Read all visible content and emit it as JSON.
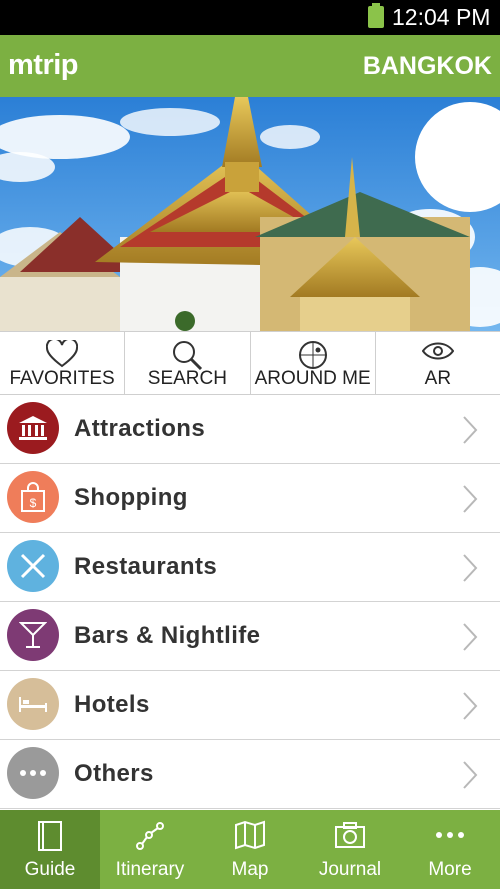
{
  "status_bar": {
    "time": "12:04 PM"
  },
  "header": {
    "app_name": "mtrip",
    "city": "BANGKOK"
  },
  "hero": {
    "image": "grand-palace-photo"
  },
  "quick_actions": [
    {
      "label": "FAVORITES",
      "icon": "heart-icon"
    },
    {
      "label": "SEARCH",
      "icon": "magnifier-icon"
    },
    {
      "label": "AROUND ME",
      "icon": "compass-icon"
    },
    {
      "label": "AR",
      "icon": "eye-icon"
    }
  ],
  "categories": [
    {
      "label": "Attractions",
      "icon": "museum-icon",
      "color": "#9b1b1f"
    },
    {
      "label": "Shopping",
      "icon": "shopping-bag-icon",
      "color": "#ef7d5a"
    },
    {
      "label": "Restaurants",
      "icon": "cutlery-icon",
      "color": "#5fb2df"
    },
    {
      "label": "Bars & Nightlife",
      "icon": "cocktail-icon",
      "color": "#7e3a74"
    },
    {
      "label": "Hotels",
      "icon": "bed-icon",
      "color": "#d6be99"
    },
    {
      "label": "Others",
      "icon": "more-dots-icon",
      "color": "#9a9a9a"
    }
  ],
  "tabs": [
    {
      "label": "Guide",
      "icon": "book-icon",
      "active": true
    },
    {
      "label": "Itinerary",
      "icon": "route-icon",
      "active": false
    },
    {
      "label": "Map",
      "icon": "map-icon",
      "active": false
    },
    {
      "label": "Journal",
      "icon": "camera-icon",
      "active": false
    },
    {
      "label": "More",
      "icon": "more-icon",
      "active": false
    }
  ],
  "colors": {
    "brand_green": "#7cb042",
    "active_tab": "#5e8c2f",
    "status_battery": "#8bc34a"
  }
}
